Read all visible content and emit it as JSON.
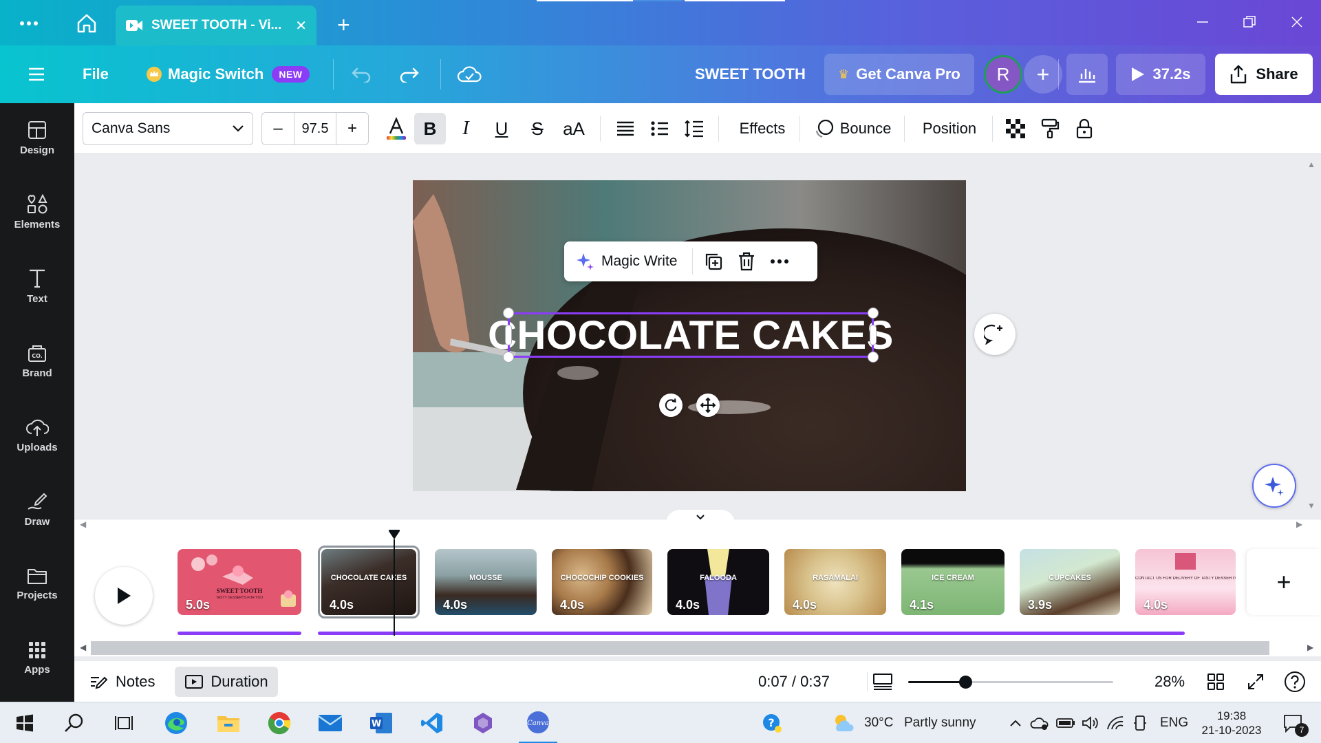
{
  "browser": {
    "tab_title": "SWEET TOOTH - Vi...",
    "window_controls": [
      "minimize-icon",
      "restore-icon",
      "close-icon"
    ]
  },
  "header": {
    "file_label": "File",
    "magic_switch_label": "Magic Switch",
    "new_badge": "NEW",
    "design_title": "SWEET TOOTH",
    "get_pro_label": "Get Canva Pro",
    "avatar_initial": "R",
    "play_duration": "37.2s",
    "share_label": "Share"
  },
  "sidebar": {
    "items": [
      {
        "label": "Design",
        "icon": "design-icon"
      },
      {
        "label": "Elements",
        "icon": "elements-icon"
      },
      {
        "label": "Text",
        "icon": "text-icon"
      },
      {
        "label": "Brand",
        "icon": "brand-icon"
      },
      {
        "label": "Uploads",
        "icon": "uploads-icon"
      },
      {
        "label": "Draw",
        "icon": "draw-icon"
      },
      {
        "label": "Projects",
        "icon": "projects-icon"
      },
      {
        "label": "Apps",
        "icon": "apps-icon"
      }
    ]
  },
  "toolbar": {
    "font_name": "Canva Sans",
    "font_size": "97.5",
    "decrease": "–",
    "increase": "+",
    "bold": "B",
    "italic": "I",
    "underline": "U",
    "strike": "S",
    "case": "aA",
    "effects_label": "Effects",
    "animation_label": "Bounce",
    "position_label": "Position"
  },
  "canvas": {
    "headline": "CHOCOLATE CAKES",
    "magic_write_label": "Magic Write"
  },
  "timeline": {
    "scenes": [
      {
        "title": "SWEET TOOTH",
        "subtitle": "TASTY DESSERTS FOR YOU",
        "duration": "5.0s"
      },
      {
        "title": "CHOCOLATE CAKES",
        "duration": "4.0s"
      },
      {
        "title": "MOUSSE",
        "duration": "4.0s"
      },
      {
        "title": "CHOCOCHIP COOKIES",
        "duration": "4.0s"
      },
      {
        "title": "FALOODA",
        "duration": "4.0s"
      },
      {
        "title": "RASAMALAI",
        "duration": "4.0s"
      },
      {
        "title": "ICE CREAM",
        "duration": "4.1s"
      },
      {
        "title": "CUPCAKES",
        "duration": "3.9s"
      },
      {
        "title": "CONTACT US FOR DELIVERY OF TASTY DESSERTS",
        "duration": "4.0s"
      }
    ],
    "add_page_label": "+"
  },
  "bottom": {
    "notes_label": "Notes",
    "duration_label": "Duration",
    "time": "0:07 / 0:37",
    "zoom": "28%",
    "zoom_level": 0.28
  },
  "taskbar": {
    "temperature": "30°C",
    "weather": "Partly sunny",
    "language": "ENG",
    "clock_time": "19:38",
    "clock_date": "21-10-2023",
    "notifications": "7"
  },
  "colors": {
    "accent_purple": "#8b3cf7",
    "header_start": "#08c4cf",
    "header_end": "#6a4ad6",
    "sidebar_bg": "#18191b"
  }
}
